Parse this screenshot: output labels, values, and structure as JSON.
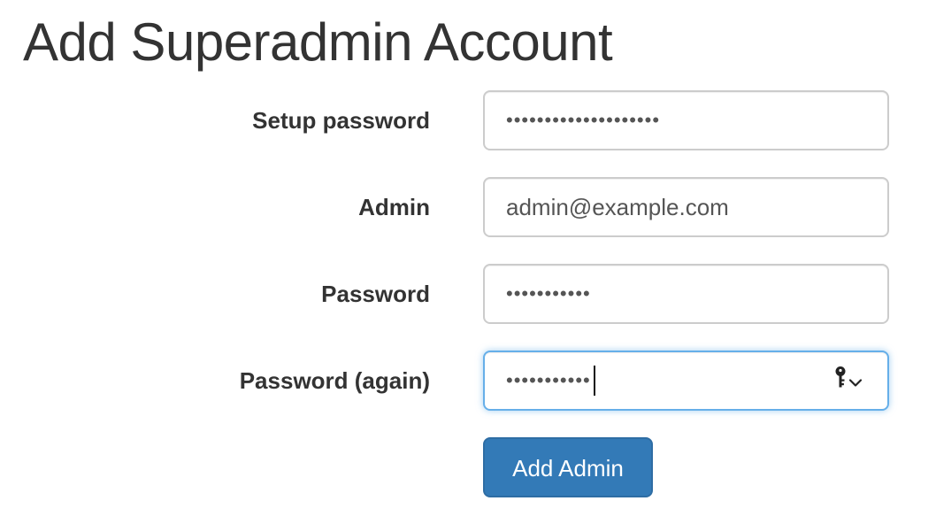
{
  "page": {
    "title": "Add Superadmin Account"
  },
  "form": {
    "setup_password": {
      "label": "Setup password",
      "masked_value": "••••••••••••••••••••"
    },
    "admin": {
      "label": "Admin",
      "value": "admin@example.com"
    },
    "password": {
      "label": "Password",
      "masked_value": "•••••••••••"
    },
    "password_again": {
      "label": "Password (again)",
      "masked_value": "•••••••••••",
      "trailing_icon": "key-icon",
      "dropdown_icon": "chevron-down-icon"
    },
    "submit": {
      "label": "Add Admin"
    }
  },
  "colors": {
    "primary_button": "#337ab7",
    "focus_border": "#66afe9",
    "input_border": "#cccccc",
    "text": "#333333"
  }
}
